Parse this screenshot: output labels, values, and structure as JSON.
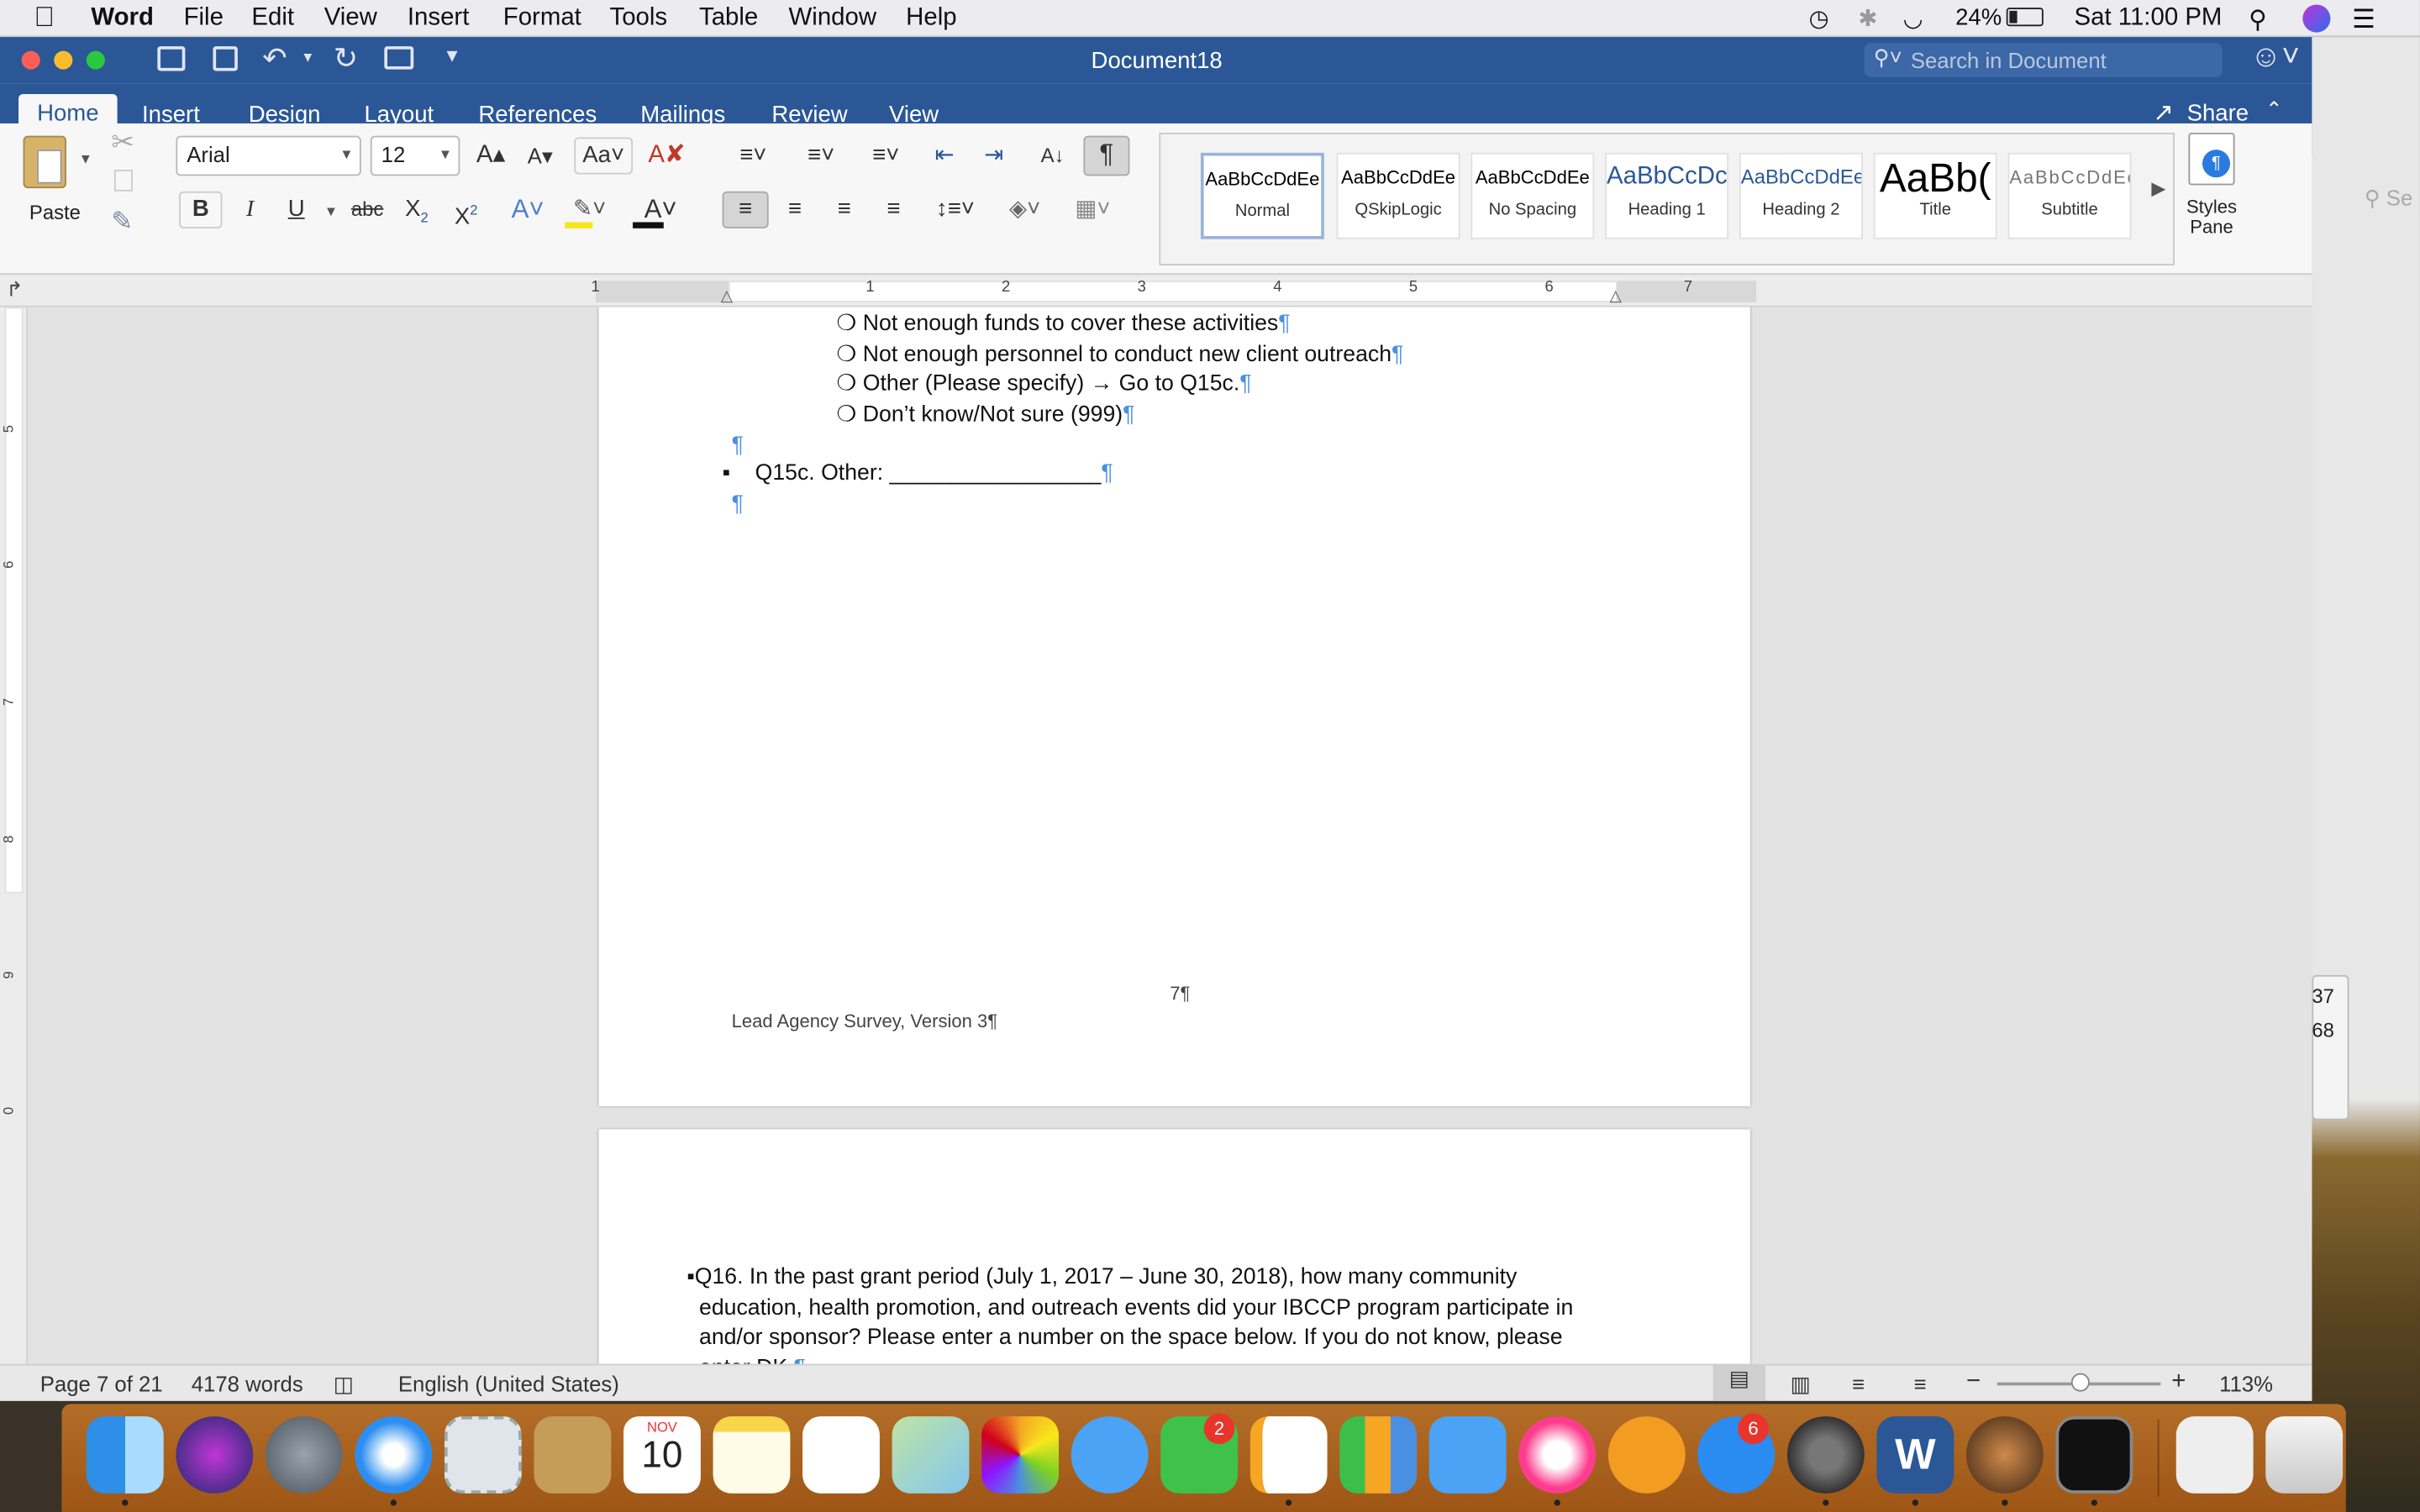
{
  "menubar": {
    "app": "Word",
    "items": [
      "File",
      "Edit",
      "View",
      "Insert",
      "Format",
      "Tools",
      "Table",
      "Window",
      "Help"
    ],
    "battery": "24%",
    "clock": "Sat 11:00 PM"
  },
  "window": {
    "title": "Document18",
    "search_placeholder": "Search in Document"
  },
  "tabs": [
    "Home",
    "Insert",
    "Design",
    "Layout",
    "References",
    "Mailings",
    "Review",
    "View"
  ],
  "share_label": "Share",
  "ribbon": {
    "paste_label": "Paste",
    "font_name": "Arial",
    "font_size": "12",
    "styles": [
      {
        "preview": "AaBbCcDdEe",
        "name": "Normal"
      },
      {
        "preview": "AaBbCcDdEe",
        "name": "QSkipLogic"
      },
      {
        "preview": "AaBbCcDdEe",
        "name": "No Spacing"
      },
      {
        "preview": "AaBbCcDc",
        "name": "Heading 1"
      },
      {
        "preview": "AaBbCcDdEe",
        "name": "Heading 2"
      },
      {
        "preview": "AaBb(",
        "name": "Title"
      },
      {
        "preview": "AaBbCcDdEe",
        "name": "Subtitle"
      }
    ],
    "styles_pane_label": "Styles Pane"
  },
  "ruler": {
    "marks": [
      "1",
      "1",
      "2",
      "3",
      "4",
      "5",
      "6",
      "7"
    ],
    "vmarks": [
      "5",
      "6",
      "7",
      "8",
      "9",
      "0"
    ]
  },
  "page7": {
    "options": [
      "Not enough funds to cover these activities",
      "Not enough personnel to conduct new client outreach",
      "Other (Please specify) → Go to Q15c.",
      "Don’t know/Not sure (999)"
    ],
    "q15c": "Q15c. Other: _________________",
    "page_number": "7",
    "footer": "Lead Agency Survey, Version 3"
  },
  "page8": {
    "q16_lines": [
      "Q16. In the past grant period (July 1, 2017 – June 30, 2018), how many community",
      "education, health promotion, and outreach events did your IBCCP program participate in",
      "and/or sponsor? Please enter a number on the space below. If you do not know, please",
      "enter DK."
    ]
  },
  "pilcrow": "¶",
  "statusbar": {
    "page": "Page 7 of 21",
    "words": "4178 words",
    "language": "English (United States)",
    "zoom": "113%"
  },
  "desktop_peek": [
    "37",
    "68"
  ],
  "dock": {
    "calendar_month": "NOV",
    "calendar_day": "10",
    "facetime_badge": "2",
    "appstore_badge": "6"
  }
}
